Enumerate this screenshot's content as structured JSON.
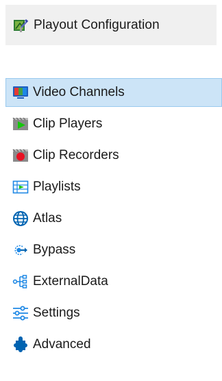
{
  "header": {
    "title": "Playout Configuration",
    "icon": "playout-config-icon"
  },
  "nav": {
    "selected_index": 0,
    "items": [
      {
        "label": "Video Channels",
        "icon": "video-channels-icon"
      },
      {
        "label": "Clip Players",
        "icon": "clip-players-icon"
      },
      {
        "label": "Clip Recorders",
        "icon": "clip-recorders-icon"
      },
      {
        "label": "Playlists",
        "icon": "playlists-icon"
      },
      {
        "label": "Atlas",
        "icon": "globe-icon"
      },
      {
        "label": "Bypass",
        "icon": "bypass-icon"
      },
      {
        "label": "ExternalData",
        "icon": "external-data-icon"
      },
      {
        "label": "Settings",
        "icon": "settings-sliders-icon"
      },
      {
        "label": "Advanced",
        "icon": "puzzle-icon"
      }
    ]
  },
  "colors": {
    "selected_bg": "#cce4f7",
    "selected_border": "#99c9ef",
    "header_bg": "#f0f0f0",
    "accent_blue": "#0063b1",
    "record_red": "#e81123",
    "play_green": "#16c60c"
  }
}
